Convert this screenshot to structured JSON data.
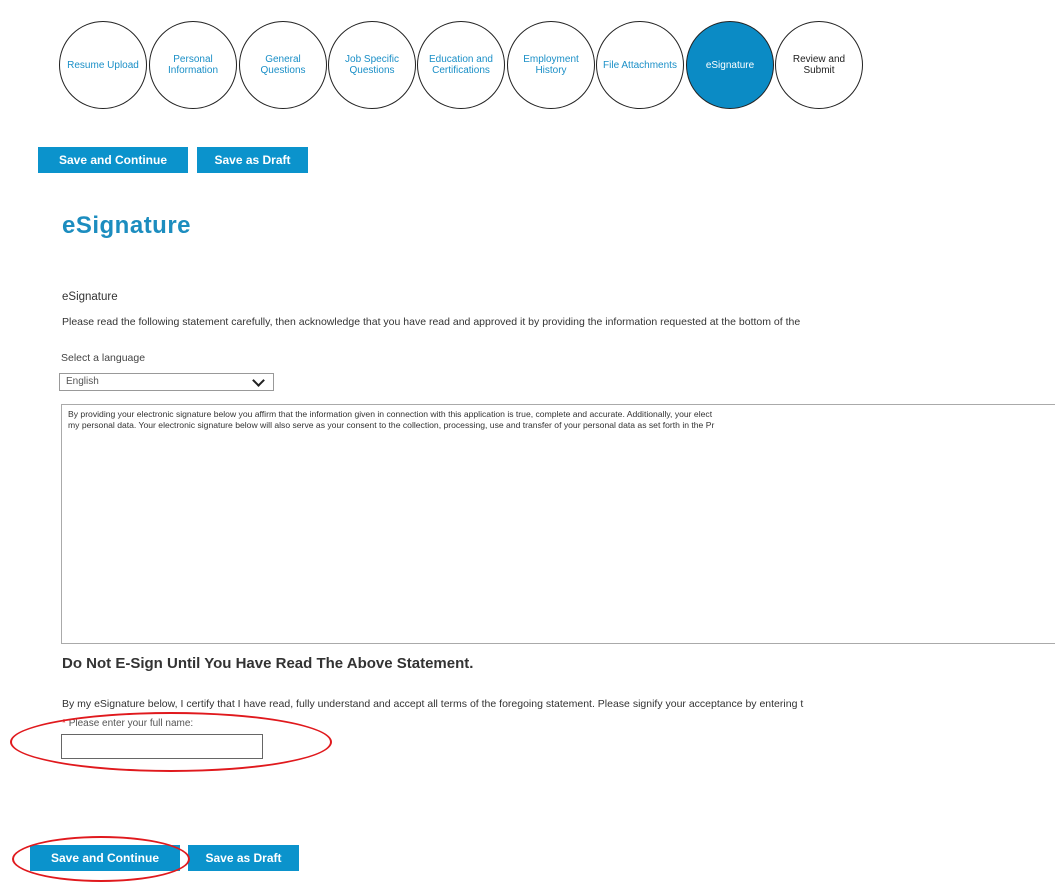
{
  "steps": [
    {
      "label": "Resume Upload"
    },
    {
      "label": "Personal Information"
    },
    {
      "label": "General Questions"
    },
    {
      "label": "Job Specific Questions"
    },
    {
      "label": "Education and Certifications"
    },
    {
      "label": "Employment History"
    },
    {
      "label": "File Attachments"
    },
    {
      "label": "eSignature"
    },
    {
      "label": "Review and Submit"
    }
  ],
  "top_actions": {
    "save_continue": "Save and Continue",
    "save_draft": "Save as Draft"
  },
  "page_title": "eSignature",
  "section_label": "eSignature",
  "instructions": "Please read the following statement carefully, then acknowledge that you have read and approved it by providing the information requested at the bottom of the",
  "language": {
    "label": "Select a language",
    "selected": "English"
  },
  "statement": {
    "line1": "By providing your electronic signature below you affirm that the information given in connection with this application is true, complete and accurate. Additionally, your elect",
    "line2": "my personal data. Your electronic signature below will also serve as your consent to the collection, processing, use and transfer of your personal data as set forth in the Pr"
  },
  "warning": "Do Not E-Sign Until You Have Read The Above Statement.",
  "certify": "By my eSignature below, I certify that I have read, fully understand and accept all terms of the foregoing statement. Please signify your acceptance by entering t",
  "name_field": {
    "required_mark": "*",
    "label": "Please enter your full name:",
    "value": ""
  },
  "bottom_actions": {
    "save_continue": "Save and Continue",
    "save_draft": "Save as Draft"
  },
  "colors": {
    "accent": "#0b93cc",
    "active_step": "#0b8bc5",
    "annotation": "#e0191d"
  }
}
